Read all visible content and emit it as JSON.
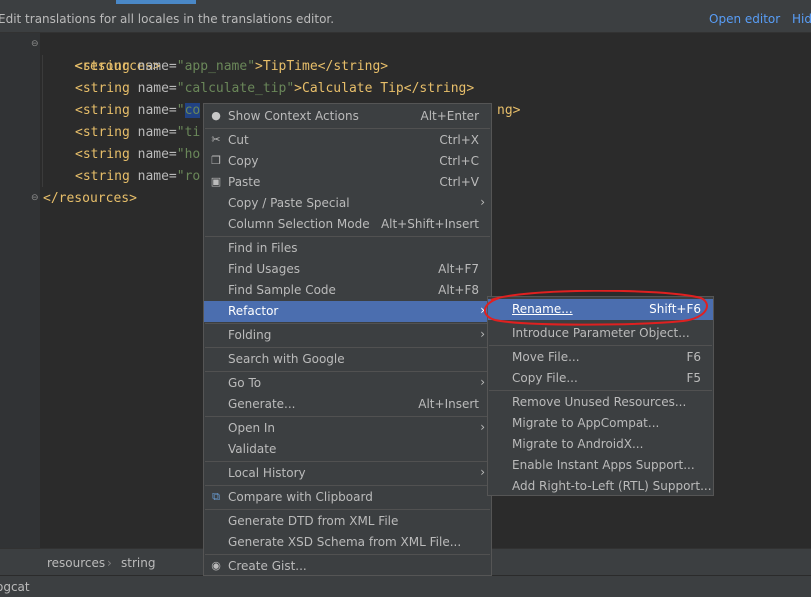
{
  "banner": {
    "message": "Edit translations for all locales in the translations editor.",
    "open_editor": "Open editor",
    "hide": "Hide"
  },
  "code": {
    "line1": "<resources>",
    "line2_a": "<string ",
    "line2_b": "name=",
    "line2_c": "\"app_name\"",
    "line2_d": ">TipTime</string>",
    "line3_a": "<string ",
    "line3_b": "name=",
    "line3_c": "\"calculate_tip\"",
    "line3_d": ">Calculate Tip</string>",
    "line4_a": "<string ",
    "line4_b": "name=",
    "line4_c": "\"",
    "line4_sel": "co",
    "line4_tail": "ng>",
    "line5_a": "<string ",
    "line5_b": "name=",
    "line5_c": "\"ti",
    "line6_a": "<string ",
    "line6_b": "name=",
    "line6_c": "\"ho",
    "line7_a": "<string ",
    "line7_b": "name=",
    "line7_c": "\"ro",
    "line8": "</resources>"
  },
  "context_menu": {
    "items": [
      {
        "label": "Show Context Actions",
        "shortcut": "Alt+Enter",
        "icon": "lightbulb-icon"
      },
      {
        "label": "Cut",
        "shortcut": "Ctrl+X",
        "icon": "scissors-icon"
      },
      {
        "label": "Copy",
        "shortcut": "Ctrl+C",
        "icon": "copy-icon"
      },
      {
        "label": "Paste",
        "shortcut": "Ctrl+V",
        "icon": "paste-icon"
      },
      {
        "label": "Copy / Paste Special",
        "shortcut": ""
      },
      {
        "label": "Column Selection Mode",
        "shortcut": "Alt+Shift+Insert"
      },
      {
        "label": "Find in Files",
        "shortcut": ""
      },
      {
        "label": "Find Usages",
        "shortcut": "Alt+F7"
      },
      {
        "label": "Find Sample Code",
        "shortcut": "Alt+F8"
      },
      {
        "label": "Refactor",
        "shortcut": ""
      },
      {
        "label": "Folding",
        "shortcut": ""
      },
      {
        "label": "Search with Google",
        "shortcut": ""
      },
      {
        "label": "Go To",
        "shortcut": ""
      },
      {
        "label": "Generate...",
        "shortcut": "Alt+Insert"
      },
      {
        "label": "Open In",
        "shortcut": ""
      },
      {
        "label": "Validate",
        "shortcut": ""
      },
      {
        "label": "Local History",
        "shortcut": ""
      },
      {
        "label": "Compare with Clipboard",
        "shortcut": "",
        "icon": "compare-icon"
      },
      {
        "label": "Generate DTD from XML File",
        "shortcut": ""
      },
      {
        "label": "Generate XSD Schema from XML File...",
        "shortcut": ""
      },
      {
        "label": "Create Gist...",
        "shortcut": "",
        "icon": "github-icon"
      }
    ]
  },
  "refactor_submenu": {
    "items": [
      {
        "label": "Rename...",
        "shortcut": "Shift+F6"
      },
      {
        "label": "Introduce Parameter Object...",
        "shortcut": ""
      },
      {
        "label": "Move File...",
        "shortcut": "F6"
      },
      {
        "label": "Copy File...",
        "shortcut": "F5"
      },
      {
        "label": "Remove Unused Resources...",
        "shortcut": ""
      },
      {
        "label": "Migrate to AppCompat...",
        "shortcut": ""
      },
      {
        "label": "Migrate to AndroidX...",
        "shortcut": ""
      },
      {
        "label": "Enable Instant Apps Support...",
        "shortcut": ""
      },
      {
        "label": "Add Right-to-Left (RTL) Support...",
        "shortcut": ""
      }
    ]
  },
  "breadcrumb": {
    "item1": "resources",
    "separator": "›",
    "item2": "string"
  },
  "bottom": {
    "tool": "ogcat"
  },
  "colors": {
    "highlight": "#4b6eaf",
    "annotation": "#e02020"
  }
}
